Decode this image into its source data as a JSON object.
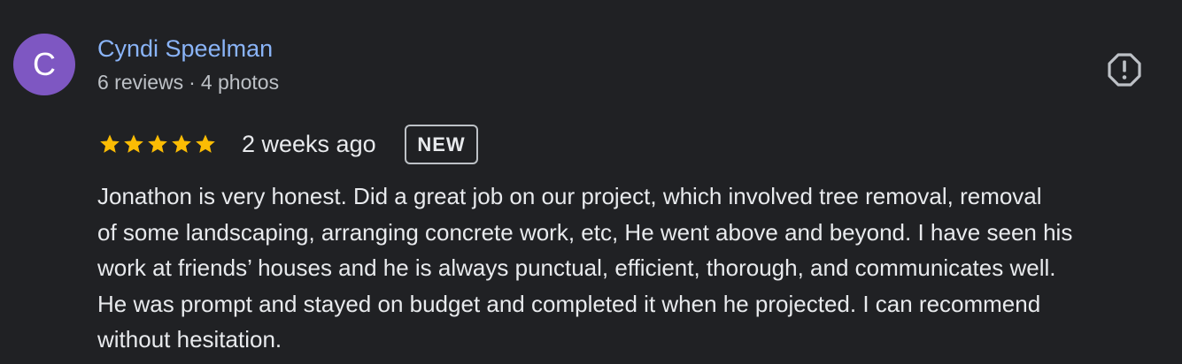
{
  "review": {
    "avatar_letter": "C",
    "avatar_color": "#7e57c2",
    "author_name": "Cyndi Speelman",
    "reviews_count": "6 reviews",
    "separator": "·",
    "photos_count": "4 photos",
    "rating": 5,
    "star_color": "#fbbc04",
    "time_ago": "2 weeks ago",
    "badge": "NEW",
    "report_icon": "report-icon",
    "text_lines": [
      "Jonathon is very honest. Did a great job on our project, which involved tree removal, removal",
      "of some landscaping, arranging concrete work, etc, He went above and beyond. I have seen his",
      "work at friends’ houses and he is always punctual, efficient, thorough, and communicates well.",
      "He was prompt and stayed on budget and completed it when he projected. I can recommend",
      "without hesitation."
    ]
  },
  "colors": {
    "background": "#202124",
    "link": "#8ab4f8",
    "text": "#e8eaed",
    "secondary_text": "#bdc1c6"
  }
}
